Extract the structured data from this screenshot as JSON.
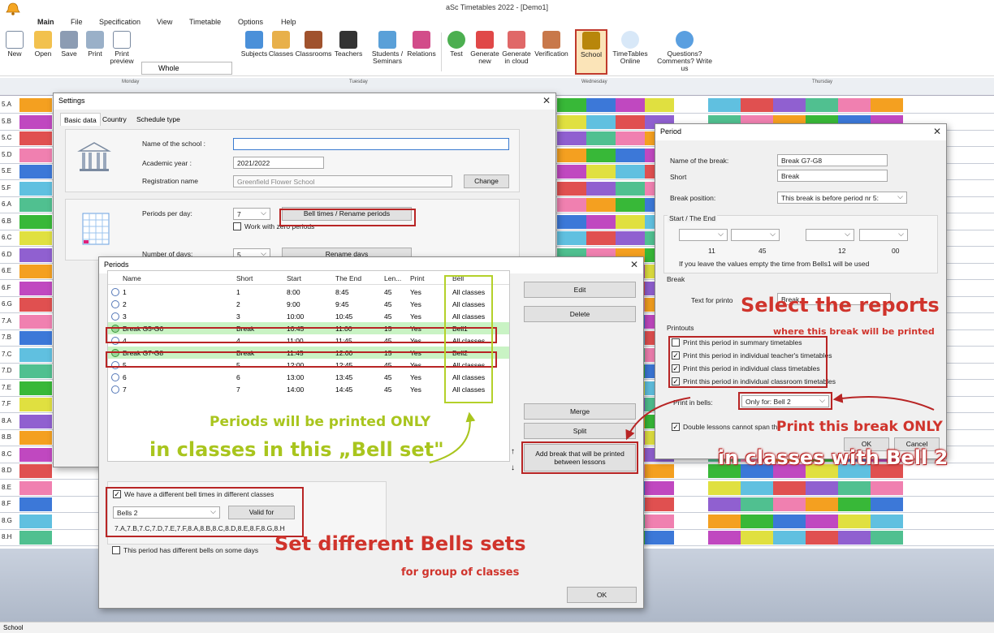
{
  "app_title": "aSc Timetables 2022  - [Demo1]",
  "menu": [
    "Main",
    "File",
    "Specification",
    "View",
    "Timetable",
    "Options",
    "Help"
  ],
  "ribbon": {
    "new": "New",
    "open": "Open",
    "save": "Save",
    "print": "Print",
    "print_preview": "Print preview",
    "view_select": "Whole",
    "subjects": "Subjects",
    "classes": "Classes",
    "classrooms": "Classrooms",
    "teachers": "Teachers",
    "students_seminars": "Students / Seminars",
    "relations": "Relations",
    "test": "Test",
    "generate_new": "Generate new",
    "generate_cloud": "Generate in cloud",
    "verification": "Verification",
    "school": "School",
    "timetables_online": "TimeTables Online",
    "questions": "Questions? Comments? Write us"
  },
  "grid": {
    "days": [
      "Monday",
      "Tuesday",
      "Wednesday",
      "Thursday"
    ],
    "rows": [
      "5.A",
      "5.B",
      "5.C",
      "5.D",
      "5.E",
      "5.F",
      "6.A",
      "6.B",
      "6.C",
      "6.D",
      "6.E",
      "6.F",
      "6.G",
      "7.A",
      "7.B",
      "7.C",
      "7.D",
      "7.E",
      "7.F",
      "8.A",
      "8.B",
      "8.C",
      "8.D",
      "8.E",
      "8.F",
      "8.G",
      "8.H"
    ]
  },
  "settings": {
    "title": "Settings",
    "tabs": [
      "Basic data",
      "Country",
      "Schedule type"
    ],
    "name_label": "Name of the school :",
    "name_value": "",
    "year_label": "Academic year :",
    "year_value": "2021/2022",
    "reg_label": "Registration name",
    "reg_value": "Greenfield Flower School",
    "change": "Change",
    "periods_label": "Periods per day:",
    "periods_value": "7",
    "bell_times_btn": "Bell times / Rename periods",
    "zero_periods": "Work with zero periods",
    "days_label": "Number of days:",
    "days_value": "5",
    "rename_days": "Rename days"
  },
  "periods": {
    "title": "Periods",
    "columns": [
      "Name",
      "Short",
      "Start",
      "The End",
      "Len...",
      "Print",
      "Bell"
    ],
    "rows": [
      {
        "name": "1",
        "short": "1",
        "start": "8:00",
        "end": "8:45",
        "len": "45",
        "print": "Yes",
        "bell": "All classes",
        "break": false
      },
      {
        "name": "2",
        "short": "2",
        "start": "9:00",
        "end": "9:45",
        "len": "45",
        "print": "Yes",
        "bell": "All classes",
        "break": false
      },
      {
        "name": "3",
        "short": "3",
        "start": "10:00",
        "end": "10:45",
        "len": "45",
        "print": "Yes",
        "bell": "All classes",
        "break": false
      },
      {
        "name": "Break G5-G6",
        "short": "Break",
        "start": "10:45",
        "end": "11:00",
        "len": "15",
        "print": "Yes",
        "bell": "Bell1",
        "break": true
      },
      {
        "name": "4",
        "short": "4",
        "start": "11:00",
        "end": "11:45",
        "len": "45",
        "print": "Yes",
        "bell": "All classes",
        "break": false
      },
      {
        "name": "Break G7-G8",
        "short": "Break",
        "start": "11:45",
        "end": "12:00",
        "len": "15",
        "print": "Yes",
        "bell": "Bell2",
        "break": true
      },
      {
        "name": "5",
        "short": "5",
        "start": "12:00",
        "end": "12:45",
        "len": "45",
        "print": "Yes",
        "bell": "All classes",
        "break": false
      },
      {
        "name": "6",
        "short": "6",
        "start": "13:00",
        "end": "13:45",
        "len": "45",
        "print": "Yes",
        "bell": "All classes",
        "break": false
      },
      {
        "name": "7",
        "short": "7",
        "start": "14:00",
        "end": "14:45",
        "len": "45",
        "print": "Yes",
        "bell": "All classes",
        "break": false
      }
    ],
    "edit": "Edit",
    "delete": "Delete",
    "merge": "Merge",
    "split": "Split",
    "add_break": "Add break that will be printed between lessons",
    "diff_bells": "We have a different bell times in different classes",
    "bells_select": "Bells 2",
    "valid_for": "Valid for",
    "valid_classes": "7.A,7.B,7.C,7.D,7.E,7.F,8.A,8.B,8.C,8.D,8.E,8.F,8.G,8.H",
    "diff_days": "This period has different bells on some days",
    "ok": "OK"
  },
  "period": {
    "title": "Period",
    "name_label": "Name of the break:",
    "name_value": "Break G7-G8",
    "short_label": "Short",
    "short_value": "Break",
    "position_label": "Break position:",
    "position_value": "This break is before period nr 5:",
    "start_end_label": "Start / The End",
    "start_h": "11",
    "start_m": "45",
    "end_h": "12",
    "end_m": "00",
    "empty_hint": "If you leave the values empty the time from Bells1 will be used",
    "break_group": "Break",
    "text_label": "Text for printo",
    "text_value": "Break",
    "printouts": "Printouts",
    "print_options": [
      {
        "label": "Print this period in summary timetables",
        "checked": false
      },
      {
        "label": "Print this period in individual teacher's timetables",
        "checked": true
      },
      {
        "label": "Print this period in individual class timetables",
        "checked": true
      },
      {
        "label": "Print this period in individual classroom timetables",
        "checked": true
      }
    ],
    "print_bells_label": "Print in bells:",
    "print_bells_value": "Only for: Bell 2",
    "double_lessons": "Double lessons cannot span thi",
    "ok": "OK",
    "cancel": "Cancel"
  },
  "notes": {
    "select_reports": "Select the reports",
    "where_printed": "where this break will be printed",
    "print_only": "Print this break ONLY",
    "in_classes_bell2": "in classes with Bell 2",
    "periods_printed": "Periods will be printed ONLY",
    "in_bell_set": "in classes in this „Bell set\"",
    "set_bells": "Set different Bells sets",
    "for_group": "for group of classes"
  },
  "status": "School",
  "colors": {
    "annotation_red": "#d0342c",
    "annotation_green": "#a9c51e",
    "break_row": "#c9f3c4",
    "school_highlight": "#fbe4b8"
  }
}
